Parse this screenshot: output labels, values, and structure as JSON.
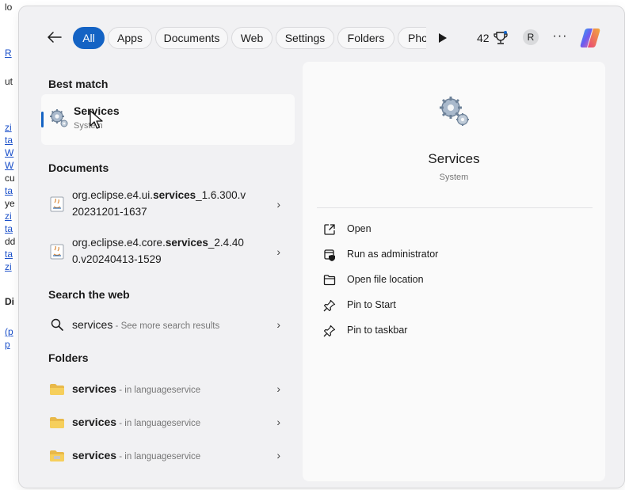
{
  "background": {
    "fragments": [
      "lo",
      "R",
      "ut",
      "zi",
      "ta",
      "W",
      "W",
      "cu",
      "ta",
      "ye",
      "zi",
      "ta",
      "dd",
      "ta",
      "zi",
      "Di",
      "(p",
      "p"
    ]
  },
  "filters": {
    "tabs": [
      "All",
      "Apps",
      "Documents",
      "Web",
      "Settings",
      "Folders",
      "Pho"
    ],
    "points": "42",
    "avatar_initial": "R",
    "more": "···"
  },
  "results": {
    "best_match_heading": "Best match",
    "best_match": {
      "title": "Services",
      "subtitle": "System"
    },
    "documents_heading": "Documents",
    "documents": [
      {
        "line1_pre": "org.eclipse.e4.ui.",
        "line1_bold": "services",
        "line1_post": "_1.6.300.v",
        "line2": "20231201-1637"
      },
      {
        "line1_pre": "org.eclipse.e4.core.",
        "line1_bold": "services",
        "line1_post": "_2.4.40",
        "line2": "0.v20240413-1529"
      }
    ],
    "web_heading": "Search the web",
    "web": {
      "query": "services",
      "hint": " - See more search results"
    },
    "folders_heading": "Folders",
    "folders": [
      {
        "name": "services",
        "location": " - in languageservice"
      },
      {
        "name": "services",
        "location": " - in languageservice"
      },
      {
        "name": "services",
        "location": " - in languageservice"
      }
    ],
    "chevron": "›"
  },
  "preview": {
    "title": "Services",
    "subtitle": "System",
    "actions": [
      "Open",
      "Run as administrator",
      "Open file location",
      "Pin to Start",
      "Pin to taskbar"
    ]
  },
  "colors": {
    "accent": "#1463c4",
    "panel": "#f1f1f3",
    "card": "#fafafa"
  }
}
